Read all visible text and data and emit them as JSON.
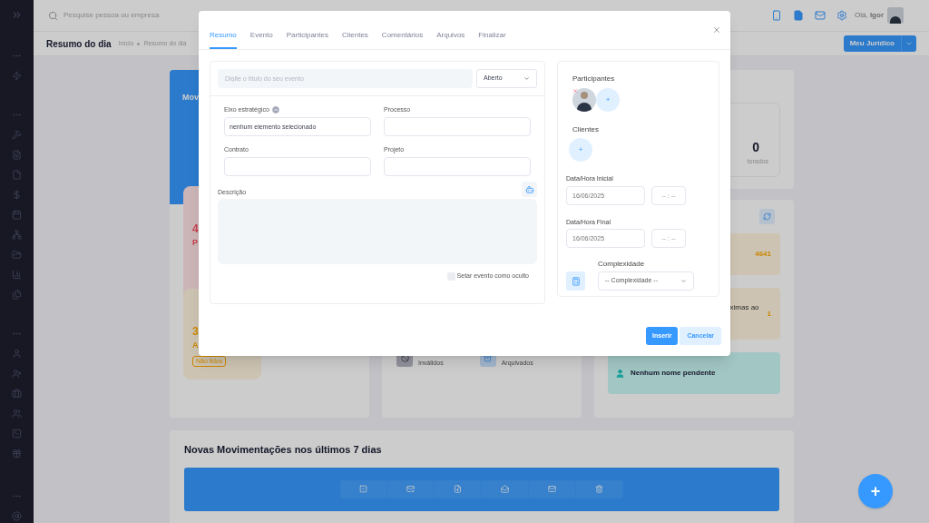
{
  "topbar": {
    "search_placeholder": "Pesquise pessoa ou empresa",
    "greeting": "Olá, **Igor**"
  },
  "header": {
    "title": "Resumo do dia",
    "breadcrumbs": [
      "Início",
      "Resumo do dia"
    ],
    "button": "Meu Jurídico"
  },
  "dashboard": {
    "blue_card_title": "Mov",
    "red_card": {
      "count": "4",
      "label": "P"
    },
    "yellow_card": {
      "count": "3",
      "label": "A",
      "badge": "Não lidos"
    },
    "status_items": [
      {
        "label": "Inválidos"
      },
      {
        "label": "Arquivados"
      }
    ],
    "monitor_card": {
      "count": "0",
      "label": "torados"
    },
    "alerts": [
      {
        "kind": "value",
        "value": "4641"
      },
      {
        "kind": "value",
        "text": "ximas ao",
        "value": "1"
      },
      {
        "kind": "info",
        "text": "Nenhum nome pendente"
      }
    ],
    "movements": {
      "title": "Novas Movimentações nos últimos 7 dias"
    }
  },
  "fab": "+",
  "modal": {
    "tabs": [
      {
        "label": "Resumo",
        "selected": true
      },
      {
        "label": "Evento",
        "selected": false
      },
      {
        "label": "Participantes",
        "selected": false
      },
      {
        "label": "Clientes",
        "selected": false
      },
      {
        "label": "Comentários",
        "selected": false
      },
      {
        "label": "Arquivos",
        "selected": false
      },
      {
        "label": "Finalizar",
        "selected": false
      }
    ],
    "title_placeholder": "Digite o título do seu evento",
    "status": "Aberto",
    "fields": [
      {
        "label": "Eixo estratégico",
        "value": "nenhum elemento selecionado",
        "clearable": true
      },
      {
        "label": "Processo",
        "clearable": false
      },
      {
        "label": "Contrato",
        "clearable": false
      },
      {
        "label": "Projeto",
        "clearable": false
      }
    ],
    "description_label": "Descrição",
    "hidden_checkbox": {
      "label": "Setar evento como oculto",
      "checked": false
    },
    "participants_label": "Participantes",
    "add_symbol": "+",
    "clients_label": "Clientes",
    "dates": [
      {
        "label": "Data/Hora Inicial",
        "date": "16/06/2025",
        "time": "-- : --"
      },
      {
        "label": "Data/Hora Final",
        "date": "16/06/2025",
        "time": "-- : --"
      }
    ],
    "complexity": {
      "label": "Complexidade",
      "value": "-- Complexidade --"
    },
    "buttons": [
      {
        "label": "Inserir",
        "kind": "primary"
      },
      {
        "label": "Cancelar",
        "kind": "secondary"
      }
    ]
  }
}
